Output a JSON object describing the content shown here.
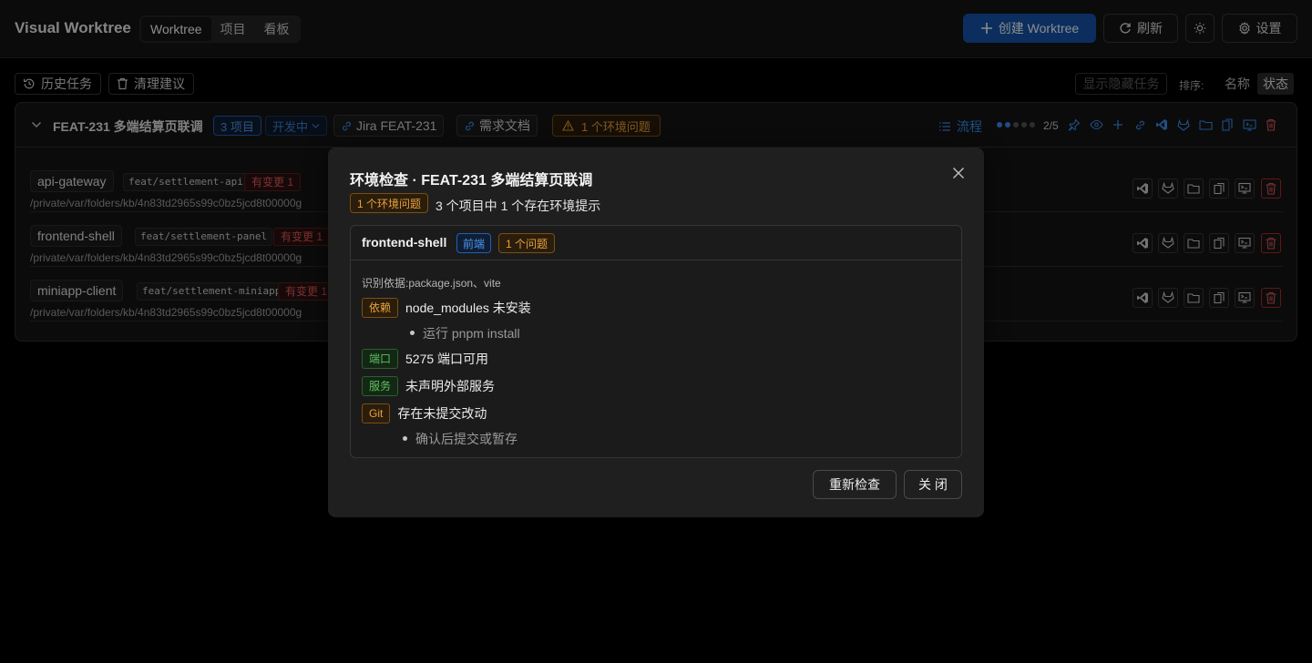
{
  "header": {
    "brand": "Visual Worktree",
    "tabs": [
      {
        "label": "Worktree",
        "active": true
      },
      {
        "label": "项目",
        "active": false
      },
      {
        "label": "看板",
        "active": false
      }
    ],
    "create_label": "创建 Worktree",
    "refresh_label": "刷新",
    "settings_label": "设置",
    "theme_icon": "sun-icon"
  },
  "toolbar": {
    "history_label": "历史任务",
    "cleanup_label": "清理建议",
    "show_hidden_label": "显示隐藏任务",
    "sort_label": "排序:",
    "sort_options": [
      {
        "label": "名称",
        "active": false
      },
      {
        "label": "状态",
        "active": true
      }
    ]
  },
  "group": {
    "title": "FEAT-231 多端结算页联调",
    "project_count": "3 项目",
    "status": "开发中",
    "jira_label": "Jira FEAT-231",
    "doc_label": "需求文档",
    "env_issue_label": "1 个环境问题",
    "flow_label": "流程",
    "progress_text": "2/5",
    "progress_value": 0.4,
    "rows": [
      {
        "repo": "api-gateway",
        "branch": "feat/settlement-api",
        "changes": "有变更 1",
        "path": "/private/var/folders/kb/4n83td2965s99c0bz5jcd8t00000g"
      },
      {
        "repo": "frontend-shell",
        "branch": "feat/settlement-panel",
        "changes": "有变更 1",
        "path": "/private/var/folders/kb/4n83td2965s99c0bz5jcd8t00000g"
      },
      {
        "repo": "miniapp-client",
        "branch": "feat/settlement-miniapp",
        "changes": "有变更 1",
        "path": "/private/var/folders/kb/4n83td2965s99c0bz5jcd8t00000g"
      }
    ]
  },
  "modal": {
    "title": "环境检查 · FEAT-231 多端结算页联调",
    "issue_badge": "1 个环境问题",
    "summary": "3 个项目中 1 个存在环境提示",
    "panel": {
      "project": "frontend-shell",
      "type_badge": "前端",
      "issue_badge": "1 个问题",
      "basis": "识别依据:package.json、vite",
      "checks": [
        {
          "tag": "依赖",
          "text": "node_modules 未安装",
          "hint": "运行 pnpm install"
        },
        {
          "tag": "端口",
          "text": "5275 端口可用"
        },
        {
          "tag": "服务",
          "text": "未声明外部服务"
        },
        {
          "tag": "Git",
          "text": "存在未提交改动",
          "hint": "确认后提交或暂存"
        }
      ]
    },
    "recheck_label": "重新检查",
    "close_label": "关 闭"
  },
  "colors": {
    "primary": "#1554ad",
    "warning": "#e8a23a",
    "success": "#5fbf5f",
    "danger": "#e35a5a",
    "accent_blue": "#3b8cf0"
  }
}
